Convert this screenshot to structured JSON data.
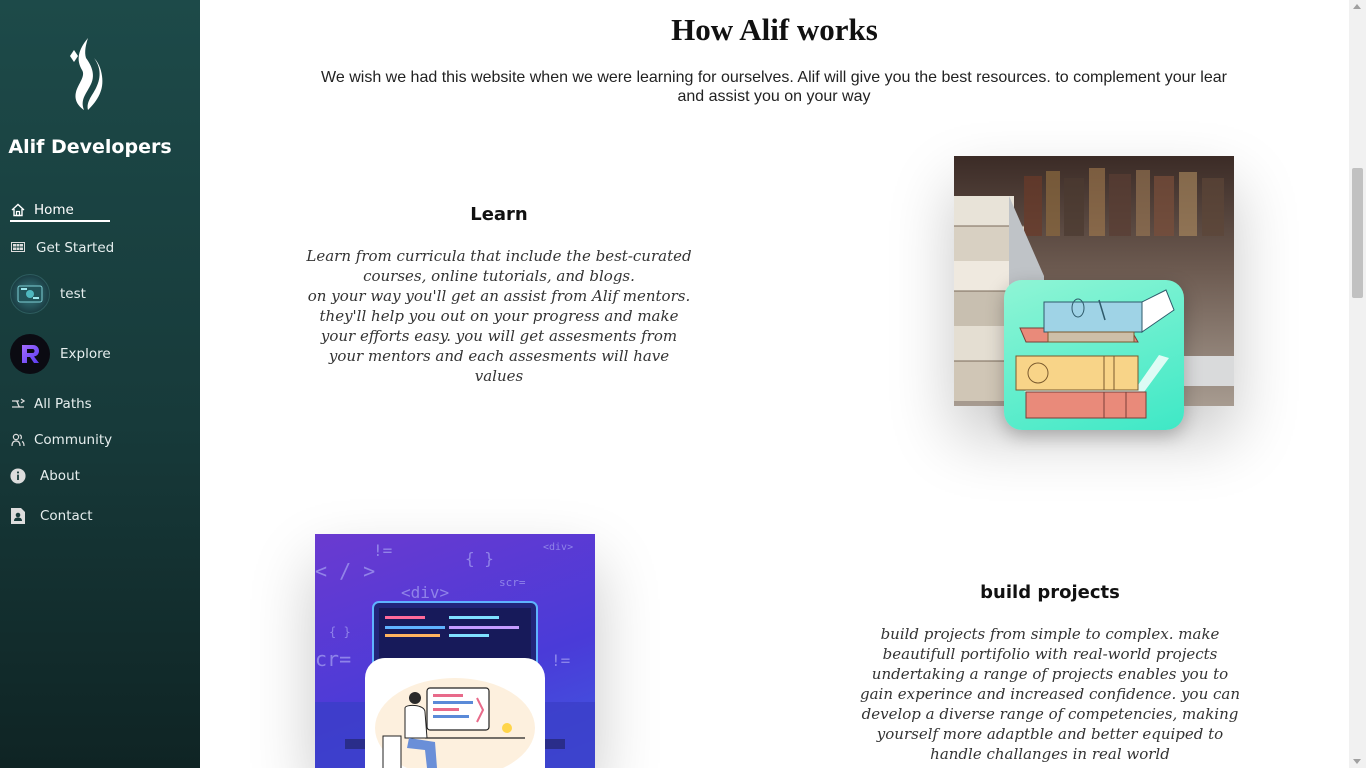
{
  "sidebar": {
    "brand": "Alif Developers",
    "items": [
      {
        "label": "Home",
        "icon": "home-icon"
      },
      {
        "label": "Get Started",
        "icon": "grid-icon"
      },
      {
        "label": "test",
        "icon": "avatar-icon"
      },
      {
        "label": "Explore",
        "icon": "r-logo-icon"
      },
      {
        "label": "All Paths",
        "icon": "paths-icon"
      },
      {
        "label": "Community",
        "icon": "community-icon"
      },
      {
        "label": "About",
        "icon": "info-icon"
      },
      {
        "label": "Contact",
        "icon": "contact-icon"
      }
    ],
    "colors": {
      "bg_top": "#1d4a49",
      "bg_bottom": "#0f2424"
    }
  },
  "main": {
    "title": "How Alif works",
    "intro_line1": "We wish we had this website when we were learning for ourselves. Alif will give you the best resources. to complement your lear",
    "intro_line2": "and assist you on your way",
    "sections": [
      {
        "title": "Learn",
        "lines": [
          "Learn from curricula that include the best-curated",
          "courses, online tutorials, and blogs.",
          "on your way you'll get an assist from Alif mentors.",
          "they'll help you out on your progress and make",
          "your efforts easy. you will get assesments from",
          "your mentors and each assesments will have",
          "values"
        ]
      },
      {
        "title": "build projects",
        "lines": [
          "build projects from simple to complex. make",
          "beautifull portifolio with real-world projects",
          "undertaking a range of projects enables you to",
          "gain experince and increased confidence. you can",
          "develop a diverse range of competencies, making",
          "yourself more adaptble and better equiped to",
          "handle challanges in real world"
        ]
      }
    ],
    "learn_image": {
      "icon": "books-illustration"
    },
    "projects_image": {
      "icon": "developer-illustration",
      "code_labels": [
        "<div>",
        "!=",
        "{ }",
        "scr=",
        "<div>",
        "cr=",
        "{ }",
        "!="
      ]
    }
  }
}
